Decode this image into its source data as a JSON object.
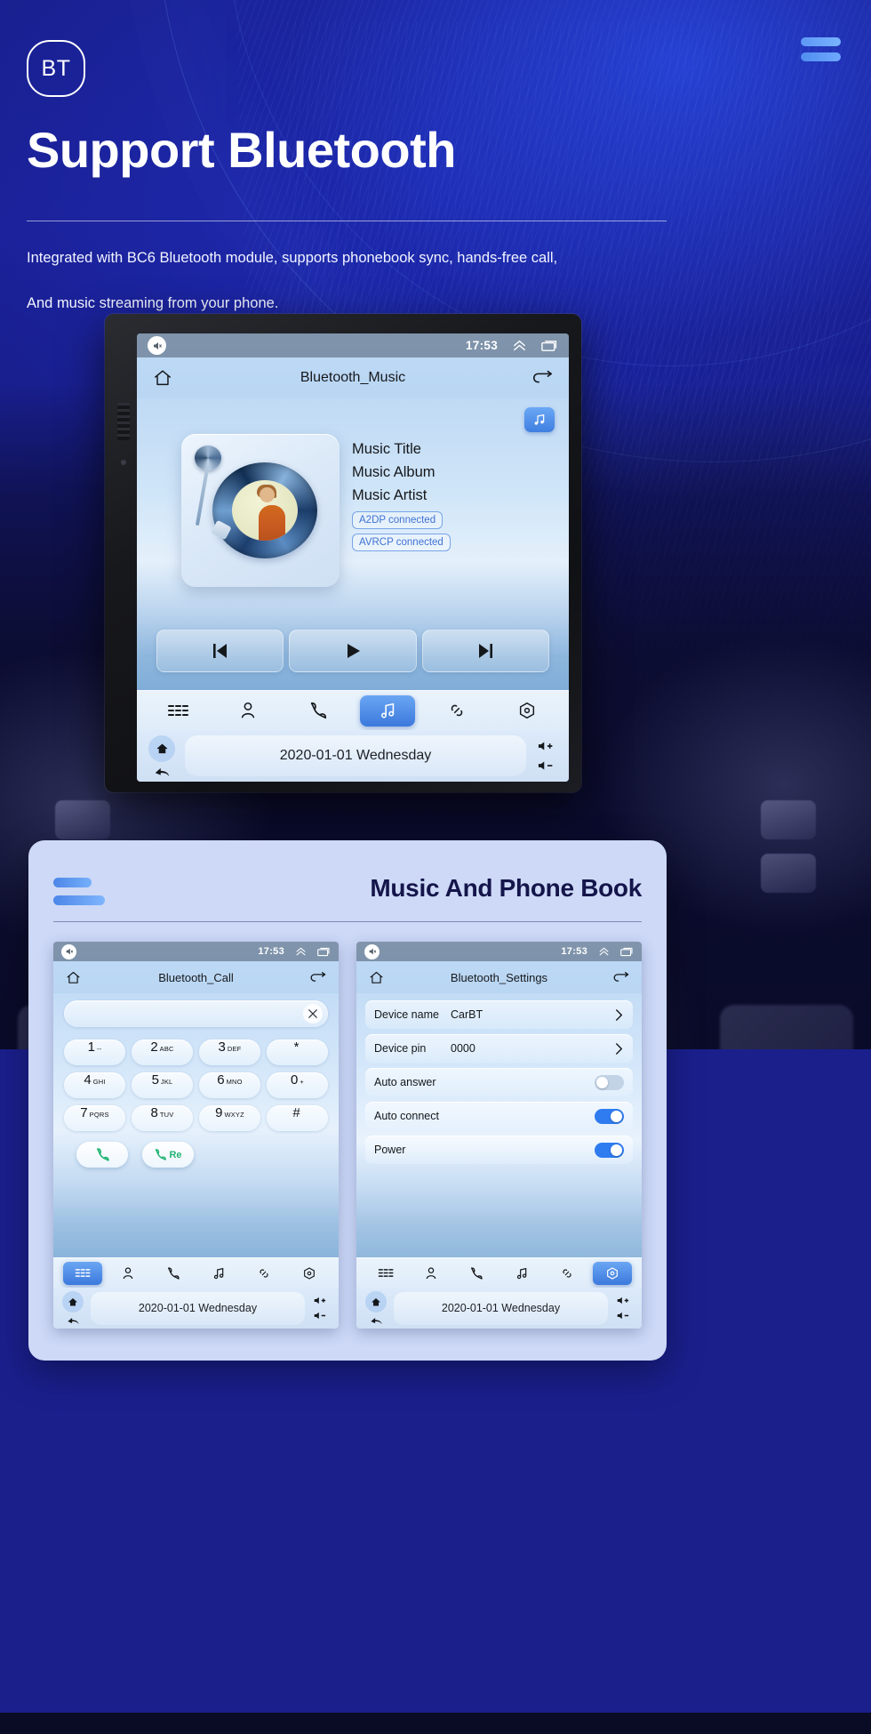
{
  "hero": {
    "badge": "BT",
    "title": "Support Bluetooth",
    "subtitle_line1": "Integrated with BC6 Bluetooth module, supports phonebook sync, hands-free call,",
    "subtitle_line2": "And music streaming from your phone.",
    "menu_icon": "hamburger-icon"
  },
  "main_device": {
    "statusbar": {
      "mute_icon": "volume-mute-icon",
      "time": "17:53",
      "expand_icon": "chevron-double-up-icon",
      "recents_icon": "recent-apps-icon"
    },
    "header": {
      "home_icon": "home-icon",
      "title": "Bluetooth_Music",
      "back_icon": "back-arrow-icon"
    },
    "music": {
      "badge_icon": "music-note-icon",
      "title": "Music Title",
      "album": "Music Album",
      "artist": "Music Artist",
      "chip_a2dp": "A2DP  connected",
      "chip_avrcp": "AVRCP connected",
      "prev_icon": "previous-track-icon",
      "play_icon": "play-icon",
      "next_icon": "next-track-icon"
    },
    "dock": [
      {
        "name": "apps-list-icon",
        "active": false
      },
      {
        "name": "contacts-icon",
        "active": false
      },
      {
        "name": "phone-icon",
        "active": false
      },
      {
        "name": "music-icon",
        "active": true
      },
      {
        "name": "link-icon",
        "active": false
      },
      {
        "name": "settings-icon",
        "active": false
      }
    ],
    "sysbar": {
      "home_icon": "home-filled-icon",
      "back_icon": "back-curved-arrow-icon",
      "date": "2020-01-01 Wednesday",
      "vol_up_icon": "volume-up-icon",
      "vol_down_icon": "volume-down-icon"
    }
  },
  "bottom_card": {
    "title": "Music And Phone Book",
    "left_screen": {
      "statusbar": {
        "mute_icon": "volume-mute-icon",
        "time": "17:53",
        "expand_icon": "chevron-double-up-icon",
        "recents_icon": "recent-apps-icon"
      },
      "header": {
        "home_icon": "home-icon",
        "title": "Bluetooth_Call",
        "back_icon": "back-arrow-icon"
      },
      "input_value": "",
      "clear_icon": "close-x-icon",
      "keys": [
        {
          "digit": "1",
          "sub": "--"
        },
        {
          "digit": "2",
          "sub": "ABC"
        },
        {
          "digit": "3",
          "sub": "DEF"
        },
        {
          "digit": "*",
          "sub": ""
        },
        {
          "digit": "4",
          "sub": "GHI"
        },
        {
          "digit": "5",
          "sub": "JKL"
        },
        {
          "digit": "6",
          "sub": "MNO"
        },
        {
          "digit": "0",
          "sub": "+"
        },
        {
          "digit": "7",
          "sub": "PQRS"
        },
        {
          "digit": "8",
          "sub": "TUV"
        },
        {
          "digit": "9",
          "sub": "WXYZ"
        },
        {
          "digit": "#",
          "sub": ""
        }
      ],
      "call_label": "",
      "redial_label": "Re",
      "dock": [
        {
          "name": "apps-list-icon",
          "active": true
        },
        {
          "name": "contacts-icon",
          "active": false
        },
        {
          "name": "phone-icon",
          "active": false
        },
        {
          "name": "music-icon",
          "active": false
        },
        {
          "name": "link-icon",
          "active": false
        },
        {
          "name": "settings-icon",
          "active": false
        }
      ],
      "sysbar": {
        "date": "2020-01-01 Wednesday"
      }
    },
    "right_screen": {
      "statusbar": {
        "mute_icon": "volume-mute-icon",
        "time": "17:53",
        "expand_icon": "chevron-double-up-icon",
        "recents_icon": "recent-apps-icon"
      },
      "header": {
        "home_icon": "home-icon",
        "title": "Bluetooth_Settings",
        "back_icon": "back-arrow-icon"
      },
      "settings": [
        {
          "label": "Device name",
          "value": "CarBT",
          "control": "chevron"
        },
        {
          "label": "Device pin",
          "value": "0000",
          "control": "chevron"
        },
        {
          "label": "Auto answer",
          "value": "",
          "control": "toggle",
          "on": false
        },
        {
          "label": "Auto connect",
          "value": "",
          "control": "toggle",
          "on": true
        },
        {
          "label": "Power",
          "value": "",
          "control": "toggle",
          "on": true
        }
      ],
      "dock": [
        {
          "name": "apps-list-icon",
          "active": false
        },
        {
          "name": "contacts-icon",
          "active": false
        },
        {
          "name": "phone-icon",
          "active": false
        },
        {
          "name": "music-icon",
          "active": false
        },
        {
          "name": "link-icon",
          "active": false
        },
        {
          "name": "settings-icon",
          "active": true
        }
      ],
      "sysbar": {
        "date": "2020-01-01 Wednesday"
      }
    }
  },
  "colors": {
    "hero_bg": "#1b2296",
    "accent_blue": "#3b79dd",
    "card_bg": "#cdd9f7",
    "toggle_on": "#2f7cf0",
    "toggle_off": "#c2d3e6",
    "chip_blue": "#3f72d4",
    "call_green": "#22b573"
  }
}
